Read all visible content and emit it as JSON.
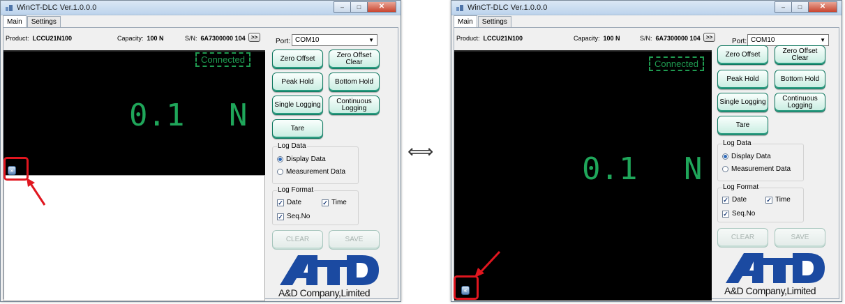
{
  "window": {
    "title": "WinCT-DLC Ver.1.0.0.0",
    "controls": {
      "minimize": "‒",
      "maximize": "□",
      "close": "✕"
    }
  },
  "tabs": [
    {
      "label": "Main",
      "active": true
    },
    {
      "label": "Settings",
      "active": false
    }
  ],
  "device": {
    "product_label": "Product:",
    "product_value": "LCCU21N100",
    "capacity_label": "Capacity:",
    "capacity_value": "100 N",
    "sn_label": "S/N:",
    "sn_value": "6A7300000 104",
    "more_label": ">>"
  },
  "port": {
    "label": "Port:",
    "value": "COM10"
  },
  "status": {
    "connected_label": "Connected"
  },
  "reading": {
    "value": "0.1",
    "unit": "N"
  },
  "buttons": {
    "zero_offset": "Zero Offset",
    "zero_offset_clear": "Zero Offset Clear",
    "peak_hold": "Peak Hold",
    "bottom_hold": "Bottom Hold",
    "single_logging": "Single Logging",
    "continuous_logging": "Continuous Logging",
    "tare": "Tare",
    "clear": "CLEAR",
    "save": "SAVE"
  },
  "log_data": {
    "title": "Log Data",
    "options": [
      {
        "label": "Display Data",
        "selected": true
      },
      {
        "label": "Measurement Data",
        "selected": false
      }
    ]
  },
  "log_format": {
    "title": "Log Format",
    "date_label": "Date",
    "date_checked": true,
    "time_label": "Time",
    "time_checked": true,
    "seq_label": "Seq.No",
    "seq_checked": true
  },
  "toggles": {
    "collapse_icon": "chevrons-down-icon",
    "expand_icon": "chevrons-up-icon"
  },
  "logo": {
    "caption": "A&D Company,Limited"
  },
  "transition": {
    "icon": "double-arrow-icon",
    "glyph": "⟺"
  },
  "colors": {
    "accent_green": "#1fa65a",
    "button_border": "#127a62",
    "highlight_red": "#e0161f",
    "logo_blue": "#1b4aa1"
  }
}
